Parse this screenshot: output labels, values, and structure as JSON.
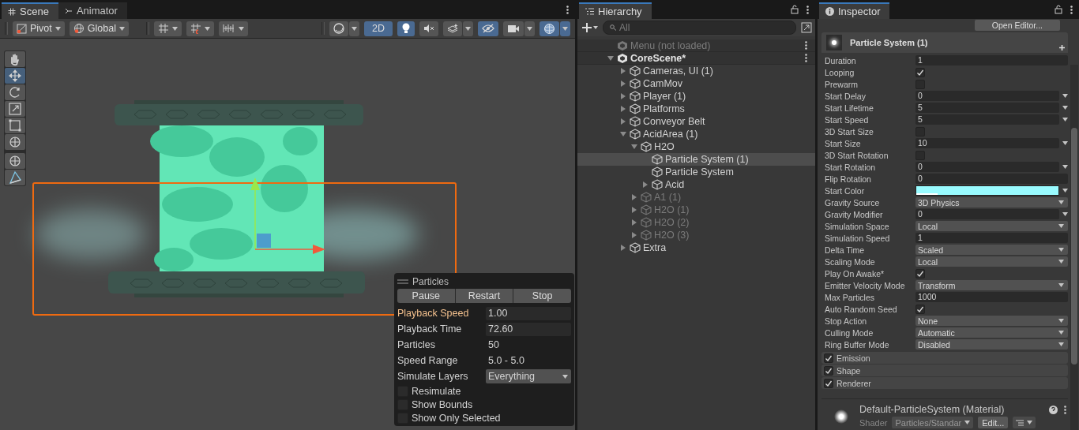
{
  "scene_panel": {
    "tabs": [
      {
        "label": "Scene",
        "kind": "scene",
        "selected": true
      },
      {
        "label": "Animator",
        "kind": "animator",
        "selected": false
      }
    ],
    "toolbar": {
      "pivot": "Pivot",
      "global": "Global",
      "snap_buttons": [
        {
          "kind": "grid"
        },
        {
          "kind": "snap"
        },
        {
          "kind": "increment"
        }
      ],
      "view_toggles": [
        {
          "kind": "drawmode",
          "on": false
        },
        {
          "kind": "twod",
          "label": "2D",
          "on": true
        },
        {
          "kind": "lighting",
          "on": true
        },
        {
          "kind": "audio",
          "on": false
        },
        {
          "kind": "effects",
          "on": false
        },
        {
          "kind": "visibility",
          "on": true
        },
        {
          "kind": "camera",
          "on": false
        },
        {
          "kind": "gizmos",
          "on": true
        }
      ]
    },
    "tools": [
      {
        "kind": "hand",
        "selected": false
      },
      {
        "kind": "move",
        "selected": true
      },
      {
        "kind": "rotate",
        "selected": false
      },
      {
        "kind": "scale",
        "selected": false
      },
      {
        "kind": "rect",
        "selected": false
      },
      {
        "kind": "transform",
        "selected": false
      },
      {
        "kind": "transform",
        "selected": false
      },
      {
        "kind": "editor",
        "selected": false
      }
    ],
    "particles_overlay": {
      "title": "Particles",
      "buttons": [
        "Pause",
        "Restart",
        "Stop"
      ],
      "fields": [
        {
          "label": "Playback Speed",
          "kind": "input",
          "value": "1.00",
          "highlight": true
        },
        {
          "label": "Playback Time",
          "kind": "input",
          "value": "72.60",
          "highlight": false
        },
        {
          "label": "Particles",
          "kind": "text",
          "value": "50",
          "highlight": false
        },
        {
          "label": "Speed Range",
          "kind": "text",
          "value": "5.0 - 5.0",
          "highlight": false
        },
        {
          "label": "Simulate Layers",
          "kind": "dropdown",
          "value": "Everything",
          "highlight": false
        }
      ],
      "checkboxes": [
        {
          "label": "Resimulate",
          "checked": false
        },
        {
          "label": "Show Bounds",
          "checked": false
        },
        {
          "label": "Show Only Selected",
          "checked": false
        }
      ]
    }
  },
  "hierarchy": {
    "title": "Hierarchy",
    "search_placeholder": "All",
    "scenes": [
      {
        "name": "Menu (not loaded)",
        "loaded": false
      },
      {
        "name": "CoreScene*",
        "loaded": true,
        "expanded": true,
        "children": [
          {
            "name": "Cameras, UI (1)",
            "expanded": false,
            "selected": false,
            "disabled": false
          },
          {
            "name": "CamMov",
            "expanded": false,
            "selected": false,
            "disabled": false
          },
          {
            "name": "Player (1)",
            "expanded": false,
            "selected": false,
            "disabled": false
          },
          {
            "name": "Platforms",
            "expanded": false,
            "selected": false,
            "disabled": false
          },
          {
            "name": "Conveyor Belt",
            "expanded": false,
            "selected": false,
            "disabled": false
          },
          {
            "name": "AcidArea (1)",
            "expanded": true,
            "selected": false,
            "disabled": false,
            "children": [
              {
                "name": "H2O",
                "expanded": true,
                "selected": false,
                "disabled": false,
                "children": [
                  {
                    "name": "Particle System (1)",
                    "selected": true,
                    "disabled": false
                  },
                  {
                    "name": "Particle System",
                    "selected": false,
                    "disabled": false
                  },
                  {
                    "name": "Acid",
                    "expanded": false,
                    "selected": false,
                    "disabled": false
                  }
                ]
              },
              {
                "name": "A1 (1)",
                "expanded": false,
                "selected": false,
                "disabled": true
              },
              {
                "name": "H2O (1)",
                "expanded": false,
                "selected": false,
                "disabled": true
              },
              {
                "name": "H2O (2)",
                "expanded": false,
                "selected": false,
                "disabled": true
              },
              {
                "name": "H2O (3)",
                "expanded": false,
                "selected": false,
                "disabled": true
              }
            ]
          },
          {
            "name": "Extra",
            "expanded": false,
            "selected": false,
            "disabled": false
          }
        ]
      }
    ]
  },
  "inspector": {
    "title": "Inspector",
    "open_editor_button": "Open Editor...",
    "component_title": "Particle System (1)",
    "properties": [
      {
        "label": "Duration",
        "kind": "input",
        "value": "1"
      },
      {
        "label": "Looping",
        "kind": "checkbox",
        "checked": true
      },
      {
        "label": "Prewarm",
        "kind": "checkbox",
        "checked": false
      },
      {
        "label": "Start Delay",
        "kind": "curve_input",
        "value": "0"
      },
      {
        "label": "Start Lifetime",
        "kind": "curve_input",
        "value": "5"
      },
      {
        "label": "Start Speed",
        "kind": "curve_input",
        "value": "5"
      },
      {
        "label": "3D Start Size",
        "kind": "checkbox",
        "checked": false
      },
      {
        "label": "Start Size",
        "kind": "curve_input",
        "value": "10"
      },
      {
        "label": "3D Start Rotation",
        "kind": "checkbox",
        "checked": false
      },
      {
        "label": "Start Rotation",
        "kind": "curve_input",
        "value": "0"
      },
      {
        "label": "Flip Rotation",
        "kind": "input",
        "value": "0"
      },
      {
        "label": "Start Color",
        "kind": "color",
        "color": "#99fbff"
      },
      {
        "label": "Gravity Source",
        "kind": "dropdown",
        "value": "3D Physics"
      },
      {
        "label": "Gravity Modifier",
        "kind": "curve_input",
        "value": "0"
      },
      {
        "label": "Simulation Space",
        "kind": "dropdown",
        "value": "Local"
      },
      {
        "label": "Simulation Speed",
        "kind": "input",
        "value": "1"
      },
      {
        "label": "Delta Time",
        "kind": "dropdown",
        "value": "Scaled"
      },
      {
        "label": "Scaling Mode",
        "kind": "dropdown",
        "value": "Local"
      },
      {
        "label": "Play On Awake*",
        "kind": "checkbox",
        "checked": true
      },
      {
        "label": "Emitter Velocity Mode",
        "kind": "dropdown",
        "value": "Transform"
      },
      {
        "label": "Max Particles",
        "kind": "input",
        "value": "1000"
      },
      {
        "label": "Auto Random Seed",
        "kind": "checkbox",
        "checked": true
      },
      {
        "label": "Stop Action",
        "kind": "dropdown",
        "value": "None"
      },
      {
        "label": "Culling Mode",
        "kind": "dropdown",
        "value": "Automatic"
      },
      {
        "label": "Ring Buffer Mode",
        "kind": "dropdown",
        "value": "Disabled"
      }
    ],
    "modules": [
      {
        "label": "Emission",
        "checked": true
      },
      {
        "label": "Shape",
        "checked": true
      },
      {
        "label": "Renderer",
        "checked": true
      }
    ],
    "material": {
      "title": "Default-ParticleSystem (Material)",
      "shader_label": "Shader",
      "shader_value": "Particles/Standar",
      "edit_button": "Edit..."
    }
  }
}
